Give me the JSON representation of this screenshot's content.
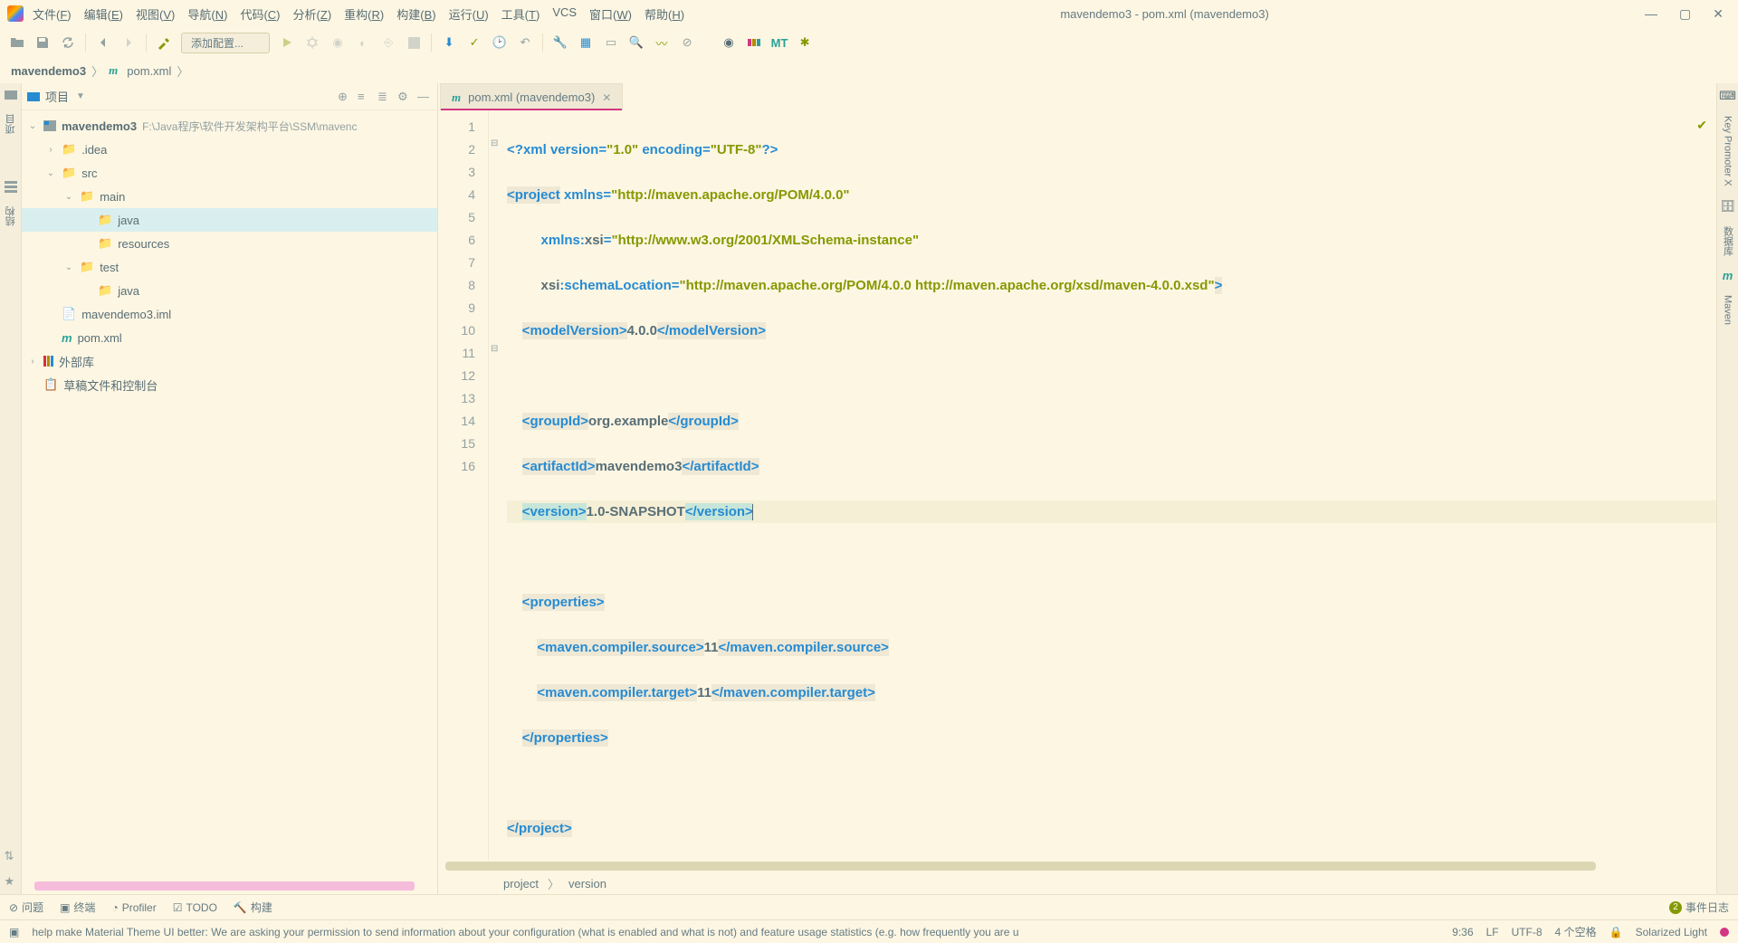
{
  "title": "mavendemo3 - pom.xml (mavendemo3)",
  "menu": [
    "文件(F)",
    "编辑(E)",
    "视图(V)",
    "导航(N)",
    "代码(C)",
    "分析(Z)",
    "重构(R)",
    "构建(B)",
    "运行(U)",
    "工具(T)",
    "VCS",
    "窗口(W)",
    "帮助(H)"
  ],
  "run_config": "添加配置...",
  "breadcrumbs": {
    "root": "mavendemo3",
    "file": "pom.xml"
  },
  "left_gutter": {
    "project_tab": "项目",
    "structure_tab": "结构"
  },
  "right_gutter": {
    "keypromoter": "Key Promoter X",
    "db": "数据库",
    "maven": "Maven"
  },
  "proj_header": {
    "title": "项目"
  },
  "tree": {
    "root": {
      "name": "mavendemo3",
      "path": "F:\\Java程序\\软件开发架构平台\\SSM\\mavenc"
    },
    "idea": ".idea",
    "src": "src",
    "main": "main",
    "java1": "java",
    "resources": "resources",
    "test": "test",
    "java2": "java",
    "iml": "mavendemo3.iml",
    "pom": "pom.xml",
    "ext": "外部库",
    "scratch": "草稿文件和控制台"
  },
  "tab": {
    "label": "pom.xml (mavendemo3)"
  },
  "code": {
    "l1": "<?xml version=\"1.0\" encoding=\"UTF-8\"?>",
    "l2": "<project xmlns=\"http://maven.apache.org/POM/4.0.0\"",
    "l3": "         xmlns:xsi=\"http://www.w3.org/2001/XMLSchema-instance\"",
    "l4": "         xsi:schemaLocation=\"http://maven.apache.org/POM/4.0.0 http://maven.apache.org/xsd/maven-4.0.0.xsd\">",
    "l5": "    <modelVersion>4.0.0</modelVersion>",
    "l7": "    <groupId>org.example</groupId>",
    "l8": "    <artifactId>mavendemo3</artifactId>",
    "l9": "    <version>1.0-SNAPSHOT</version>",
    "l11": "    <properties>",
    "l12": "        <maven.compiler.source>11</maven.compiler.source>",
    "l13": "        <maven.compiler.target>11</maven.compiler.target>",
    "l14": "    </properties>",
    "l16": "</project>"
  },
  "editor_crumbs": {
    "a": "project",
    "b": "version"
  },
  "bottom": {
    "problems": "问题",
    "terminal": "终端",
    "profiler": "Profiler",
    "todo": "TODO",
    "build": "构建",
    "eventlog": "事件日志",
    "badge": "2"
  },
  "status": {
    "msg": "help make Material Theme UI better: We are asking your permission to send information about your configuration (what is enabled and what is not) and feature usage statistics (e.g. how frequently you are u",
    "pos": "9:36",
    "eol": "LF",
    "enc": "UTF-8",
    "indent": "4 个空格",
    "theme": "Solarized Light"
  }
}
